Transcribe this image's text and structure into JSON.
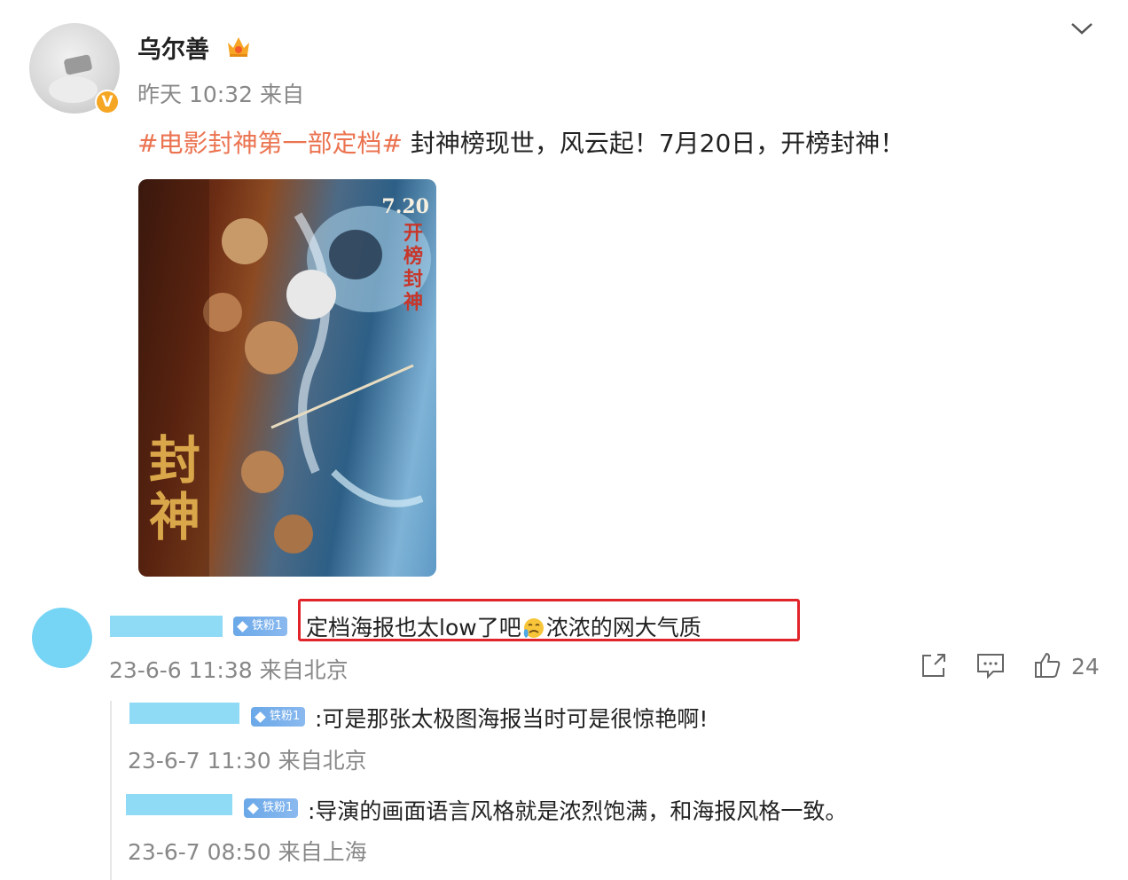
{
  "post": {
    "username": "乌尔善",
    "time": "昨天 10:32",
    "source": "来自",
    "hashtag": "#电影封神第一部定档#",
    "text": " 封神榜现世，风云起！7月20日，开榜封神！",
    "poster": {
      "title_line1": "封",
      "title_line2": "神",
      "date": "7.20",
      "slogan": "开榜封神"
    }
  },
  "comment": {
    "badge": "铁粉1",
    "text_before_emoji": "定档海报也太low了吧",
    "text_after_emoji": "浓浓的网大气质",
    "emoji_icon": "crying-face-icon",
    "time": "23-6-6 11:38 来自北京",
    "like_count": "24"
  },
  "replies": [
    {
      "badge": "铁粉1",
      "text": ":可是那张太极图海报当时可是很惊艳啊!",
      "time": "23-6-7 11:30 来自北京"
    },
    {
      "badge": "铁粉1",
      "text": ":导演的画面语言风格就是浓烈饱满，和海报风格一致。",
      "time": "23-6-7 08:50 来自上海"
    }
  ],
  "colors": {
    "hashtag": "#eb7350",
    "highlight_box": "#e0242a",
    "badge": "#6aa8e8",
    "verified": "#f5a623"
  }
}
